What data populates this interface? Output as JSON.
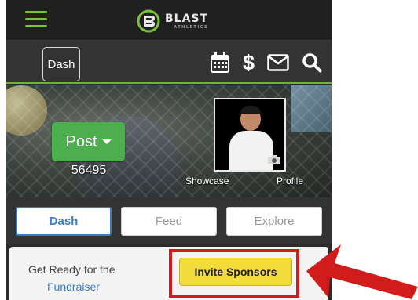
{
  "header": {
    "brand_name": "BLAST",
    "brand_tagline": "ATHLETICS",
    "accent_color": "#7cc13f"
  },
  "navbar": {
    "dash_label": "Dash",
    "icons": [
      "calendar-icon",
      "dollar-icon",
      "mail-icon",
      "search-icon"
    ],
    "dollar_symbol": "$"
  },
  "hero": {
    "post_label": "Post",
    "post_count": "56495",
    "showcase_label": "Showcase",
    "profile_label": "Profile"
  },
  "tabs": [
    {
      "label": "Dash",
      "active": true
    },
    {
      "label": "Feed",
      "active": false
    },
    {
      "label": "Explore",
      "active": false
    }
  ],
  "card": {
    "line1": "Get Ready for the",
    "link": "Fundraiser",
    "invite_label": "Invite Sponsors",
    "invite_color": "#f2dc3c"
  },
  "annotation": {
    "color": "#d21c1c"
  }
}
